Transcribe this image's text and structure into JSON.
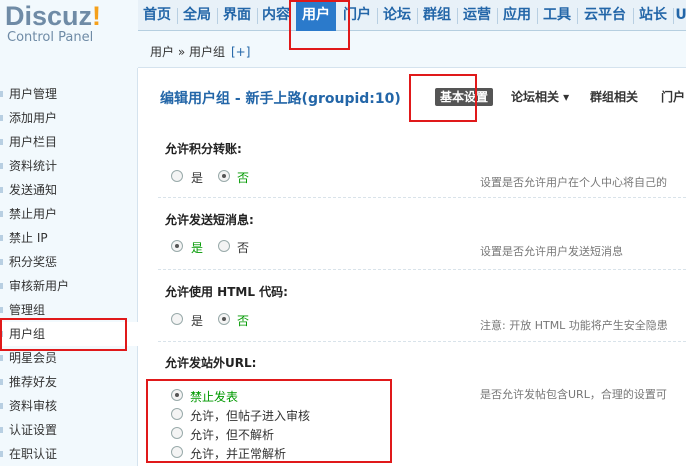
{
  "logo": {
    "text": "Discuz",
    "bang": "!",
    "subtitle": "Control Panel"
  },
  "topnav": [
    {
      "label": "首页",
      "active": false
    },
    {
      "label": "全局",
      "active": false
    },
    {
      "label": "界面",
      "active": false
    },
    {
      "label": "内容",
      "active": false
    },
    {
      "label": "用户",
      "active": true
    },
    {
      "label": "门户",
      "active": false
    },
    {
      "label": "论坛",
      "active": false
    },
    {
      "label": "群组",
      "active": false
    },
    {
      "label": "运营",
      "active": false
    },
    {
      "label": "应用",
      "active": false
    },
    {
      "label": "工具",
      "active": false
    },
    {
      "label": "云平台",
      "active": false
    },
    {
      "label": "站长",
      "active": false
    },
    {
      "label": "U",
      "active": false
    }
  ],
  "breadcrumb": {
    "path": "用户 » 用户组",
    "add": "[+]"
  },
  "sidebar": [
    "用户管理",
    "添加用户",
    "用户栏目",
    "资料统计",
    "发送通知",
    "禁止用户",
    "禁止 IP",
    "积分奖惩",
    "审核新用户",
    "管理组",
    "用户组",
    "明星会员",
    "推荐好友",
    "资料审核",
    "认证设置",
    "在职认证"
  ],
  "sidebar_active": "用户组",
  "edit": {
    "title": "编辑用户组 - 新手上路(groupid:10)",
    "tabs": {
      "basic": "基本设置",
      "forum": "论坛相关 ▾",
      "group": "群组相关",
      "portal": "门户"
    }
  },
  "settings": [
    {
      "title": "允许积分转账:",
      "options": [
        "是",
        "否"
      ],
      "selected": "否",
      "hint": "设置是否允许用户在个人中心将自己的"
    },
    {
      "title": "允许发送短消息:",
      "options": [
        "是",
        "否"
      ],
      "selected": "是",
      "hint": "设置是否允许用户发送短消息"
    },
    {
      "title": "允许使用 HTML 代码:",
      "options": [
        "是",
        "否"
      ],
      "selected": "否",
      "hint": "注意: 开放 HTML 功能将产生安全隐患"
    },
    {
      "title": "允许发站外URL:",
      "options": [
        "禁止发表",
        "允许，但帖子进入审核",
        "允许，但不解析",
        "允许，并正常解析"
      ],
      "selected": "禁止发表",
      "hint": "是否允许发帖包含URL，合理的设置可"
    }
  ],
  "colors": {
    "accent": "#2b7acb",
    "selected_text": "#009900",
    "highlight": "#e0191a"
  }
}
